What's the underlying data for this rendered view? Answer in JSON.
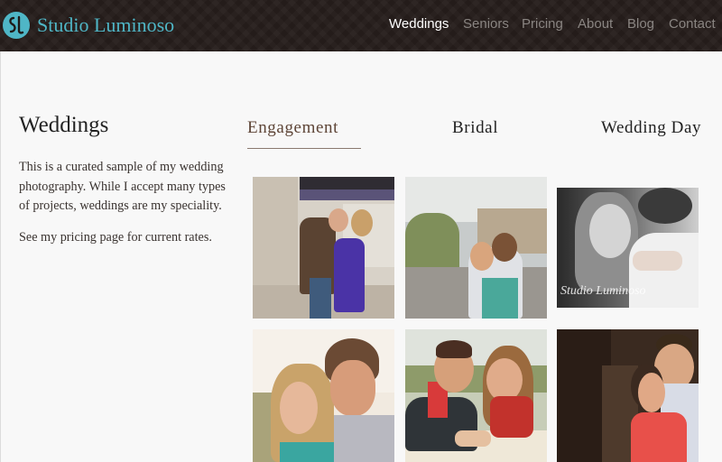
{
  "brand": {
    "name": "Studio Luminoso",
    "logo_icon": "sl-monogram-icon",
    "accent": "#4fb6c6"
  },
  "nav": {
    "items": [
      {
        "label": "Weddings",
        "active": true
      },
      {
        "label": "Seniors",
        "active": false
      },
      {
        "label": "Pricing",
        "active": false
      },
      {
        "label": "About",
        "active": false
      },
      {
        "label": "Blog",
        "active": false
      },
      {
        "label": "Contact",
        "active": false
      }
    ]
  },
  "page": {
    "title": "Weddings",
    "intro": "This is a curated sample of my wedding photography. While I accept many types of projects, weddings are my speciality.",
    "pricing_note": "See my pricing page for current rates."
  },
  "tabs": [
    {
      "label": "Engagement",
      "active": true
    },
    {
      "label": "Bridal",
      "active": false
    },
    {
      "label": "Wedding Day",
      "active": false
    }
  ],
  "gallery": {
    "watermark": "Studio Luminoso"
  }
}
